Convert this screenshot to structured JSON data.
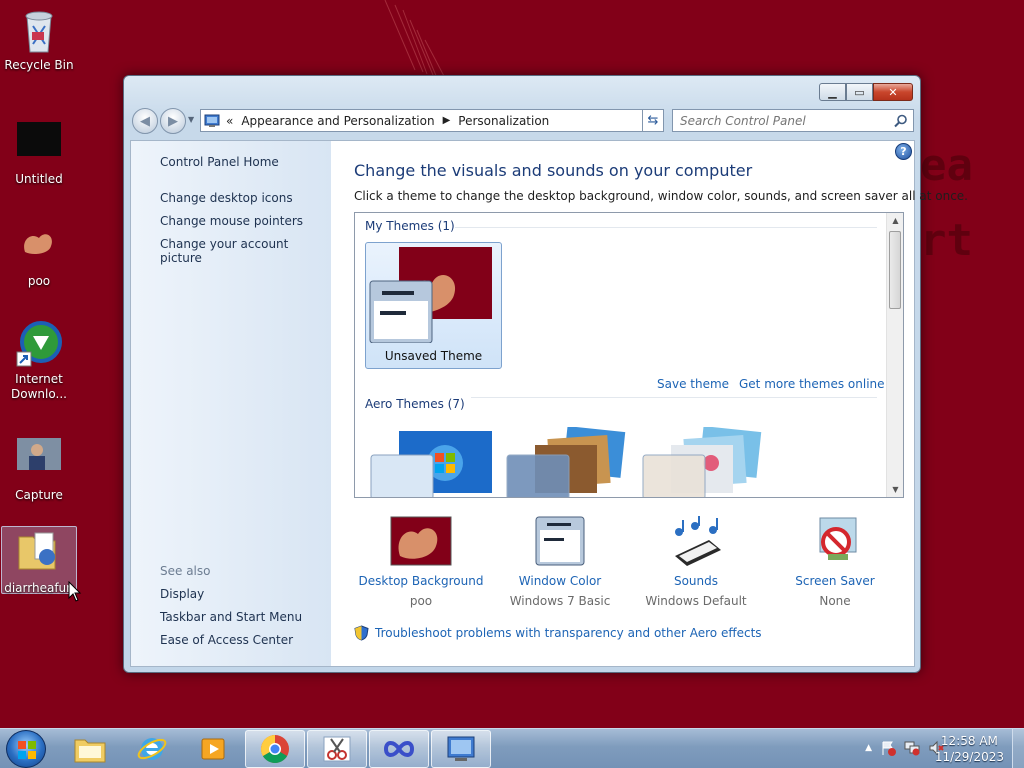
{
  "desktop": {
    "icons": [
      {
        "label": "Recycle Bin",
        "icon": "recycle-bin-icon"
      },
      {
        "label": "Untitled",
        "icon": "black-image-icon"
      },
      {
        "label": "poo",
        "icon": "image-icon"
      },
      {
        "label": "Internet Downlo...",
        "icon": "internet-download-manager-icon"
      },
      {
        "label": "Capture",
        "icon": "photo-icon"
      },
      {
        "label": "diarrheafun",
        "icon": "folder-icon"
      }
    ]
  },
  "window": {
    "address": {
      "chevron": "«",
      "crumbs": [
        "Appearance and Personalization",
        "Personalization"
      ]
    },
    "search_placeholder": "Search Control Panel"
  },
  "left_pane": {
    "home": "Control Panel Home",
    "links": [
      "Change desktop icons",
      "Change mouse pointers",
      "Change your account picture"
    ],
    "see_also_label": "See also",
    "see_also": [
      "Display",
      "Taskbar and Start Menu",
      "Ease of Access Center"
    ]
  },
  "main": {
    "heading": "Change the visuals and sounds on your computer",
    "subheading": "Click a theme to change the desktop background, window color, sounds, and screen saver all at once.",
    "my_themes_label": "My Themes (1)",
    "unsaved_theme": "Unsaved Theme",
    "save_theme": "Save theme",
    "get_more": "Get more themes online",
    "aero_label": "Aero Themes (7)",
    "bottom": [
      {
        "title": "Desktop Background",
        "value": "poo",
        "icon": "desktop-background-icon"
      },
      {
        "title": "Window Color",
        "value": "Windows 7 Basic",
        "icon": "window-color-icon"
      },
      {
        "title": "Sounds",
        "value": "Windows Default",
        "icon": "sounds-icon"
      },
      {
        "title": "Screen Saver",
        "value": "None",
        "icon": "screen-saver-icon"
      }
    ],
    "troubleshoot": "Troubleshoot problems with transparency and other Aero effects"
  },
  "taskbar": {
    "time": "12:58 AM",
    "date": "11/29/2023"
  },
  "colors": {
    "wallpaper": "#820018",
    "link": "#1d64b5",
    "heading": "#1c3c78"
  }
}
